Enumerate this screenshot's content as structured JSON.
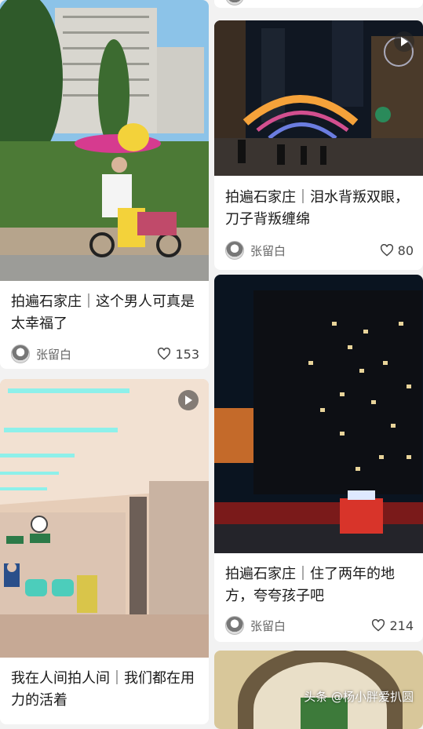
{
  "cards": [
    {
      "title": "拍遍石家庄｜这个男人可真是太幸福了",
      "author": "张留白",
      "likes": "153",
      "image": "man-with-balloons-on-bike"
    },
    {
      "title": "拍遍石家庄｜泪水背叛双眼，刀子背叛缠绵",
      "author": "张留白",
      "likes": "80",
      "image": "pedestrian-street-night"
    },
    {
      "title": "拍遍石家庄｜住了两年的地方，夸夸孩子吧",
      "author": "张留白",
      "likes": "214",
      "image": "apartment-night-vendor"
    },
    {
      "title": "我在人间拍人间｜我们都在用力的活着",
      "author": "",
      "likes": "",
      "image": "hospital-corridor"
    },
    {
      "title": "",
      "author": "",
      "likes": "",
      "image": "arched-window"
    }
  ],
  "top_right_likes_partial": "",
  "watermark": "头条 @杨小胖爱扒圆",
  "icons": {
    "like": "heart-outline-icon",
    "play": "play-icon",
    "avatar": "author-avatar-icon"
  },
  "colors": {
    "background": "#f2f2f2",
    "card": "#ffffff",
    "text": "#1a1a1a",
    "meta": "#666666"
  }
}
